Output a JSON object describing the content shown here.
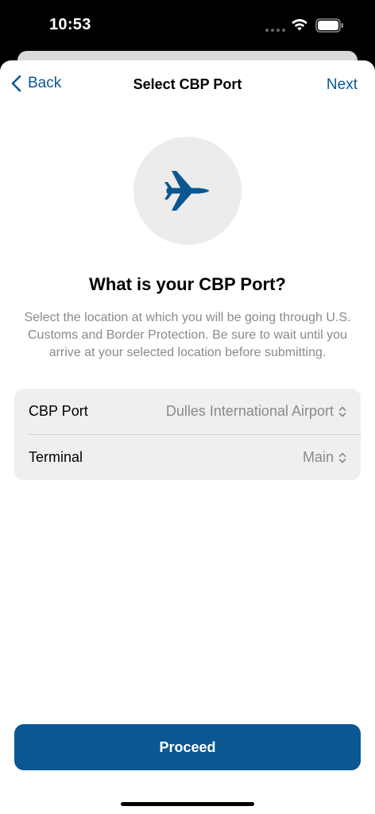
{
  "status_bar": {
    "time": "10:53"
  },
  "nav": {
    "back_label": "Back",
    "title": "Select CBP Port",
    "next_label": "Next"
  },
  "hero": {
    "icon": "airplane-icon",
    "heading": "What is your CBP Port?",
    "description": "Select the location at which you will be going through U.S. Customs and Border Protection. Be sure to wait until you arrive at your selected location before submitting."
  },
  "form": {
    "rows": [
      {
        "label": "CBP Port",
        "value": "Dulles International Airport"
      },
      {
        "label": "Terminal",
        "value": "Main"
      }
    ]
  },
  "footer": {
    "proceed_label": "Proceed"
  },
  "colors": {
    "accent": "#0a5792",
    "secondary_text": "#8a8a8e",
    "card_background": "#efeff0"
  }
}
